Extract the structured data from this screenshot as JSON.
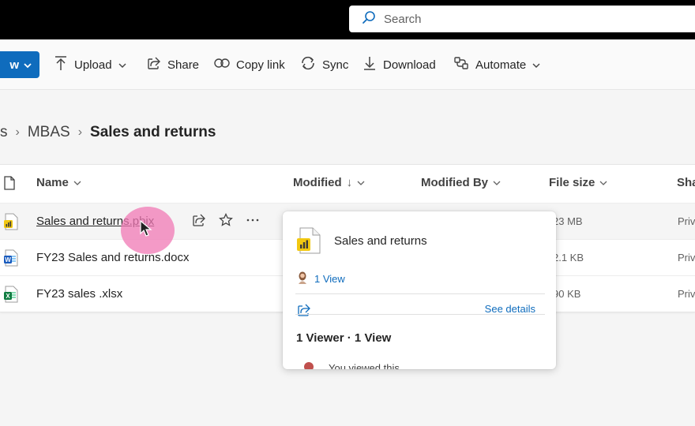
{
  "search": {
    "placeholder": "Search"
  },
  "toolbar": {
    "new_label": "w",
    "upload_label": "Upload",
    "share_label": "Share",
    "copy_link_label": "Copy link",
    "sync_label": "Sync",
    "download_label": "Download",
    "automate_label": "Automate"
  },
  "breadcrumb": {
    "partial": "s",
    "parent": "MBAS",
    "current": "Sales and returns"
  },
  "columns": {
    "name": "Name",
    "modified": "Modified",
    "modified_by": "Modified By",
    "file_size": "File size",
    "sharing": "Sha"
  },
  "files": [
    {
      "name": "Sales and returns.pbix",
      "type": "pbix",
      "size": "23 MB",
      "sharing": "Priva"
    },
    {
      "name": "FY23 Sales and returns.docx",
      "type": "docx",
      "size": "2.1 KB",
      "sharing": "Priva"
    },
    {
      "name": "FY23 sales .xlsx",
      "type": "xlsx",
      "size": "90 KB",
      "sharing": "Priva"
    }
  ],
  "hover_card": {
    "title": "Sales and returns",
    "views": "1 View",
    "see_details": "See details",
    "summary": "1 Viewer · 1 View",
    "recent_activity": "You viewed this"
  },
  "colors": {
    "accent": "#0f6cbd",
    "powerbi": "#f2c811",
    "word": "#185abd",
    "excel": "#107c41",
    "highlight": "#f078b4"
  }
}
